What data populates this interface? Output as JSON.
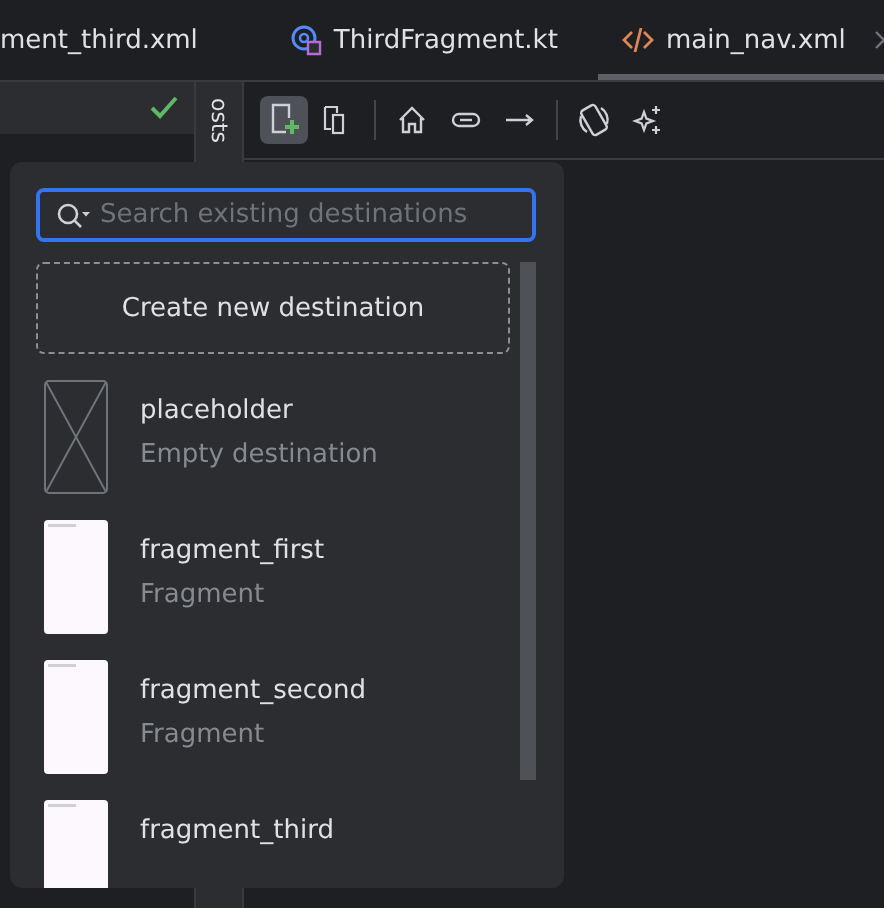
{
  "tabs": [
    {
      "label": "ment_third.xml",
      "kind": "plain",
      "selected": false
    },
    {
      "label": "ThirdFragment.kt",
      "kind": "kotlin",
      "selected": false
    },
    {
      "label": "main_nav.xml",
      "kind": "xml",
      "selected": true
    }
  ],
  "side_strip": {
    "label": "osts"
  },
  "toolbar": [
    {
      "kind": "new-destination",
      "selected": true
    },
    {
      "kind": "copy",
      "selected": false
    },
    {
      "kind": "home",
      "selected": false
    },
    {
      "kind": "link",
      "selected": false
    },
    {
      "kind": "arrow",
      "selected": false
    },
    {
      "kind": "rotate",
      "selected": false
    },
    {
      "kind": "sparkle",
      "selected": false
    }
  ],
  "popup": {
    "search": {
      "placeholder": "Search existing destinations"
    },
    "create_button": "Create new destination",
    "destinations": [
      {
        "name": "placeholder",
        "type": "Empty destination",
        "kind": "placeholder"
      },
      {
        "name": "fragment_first",
        "type": "Fragment",
        "kind": "fragment"
      },
      {
        "name": "fragment_second",
        "type": "Fragment",
        "kind": "fragment"
      },
      {
        "name": "fragment_third",
        "kind": "fragment"
      }
    ]
  }
}
